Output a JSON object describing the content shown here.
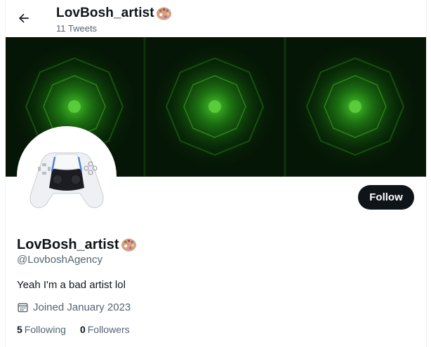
{
  "header": {
    "title": "LovBosh_artist",
    "tweet_count": "11 Tweets",
    "back_icon": "arrow-left-icon"
  },
  "profile": {
    "display_name": "LovBosh_artist",
    "name_emoji": "artist-palette-icon",
    "handle": "@LovboshAgency",
    "bio": "Yeah I'm a bad artist lol",
    "joined": "Joined January 2023",
    "follow_label": "Follow",
    "following_count": "5",
    "following_label": "Following",
    "followers_count": "0",
    "followers_label": "Followers"
  },
  "colors": {
    "text": "#0f1419",
    "muted": "#536471",
    "follow_bg": "#0f1419",
    "banner_green": "#2fa11f"
  }
}
